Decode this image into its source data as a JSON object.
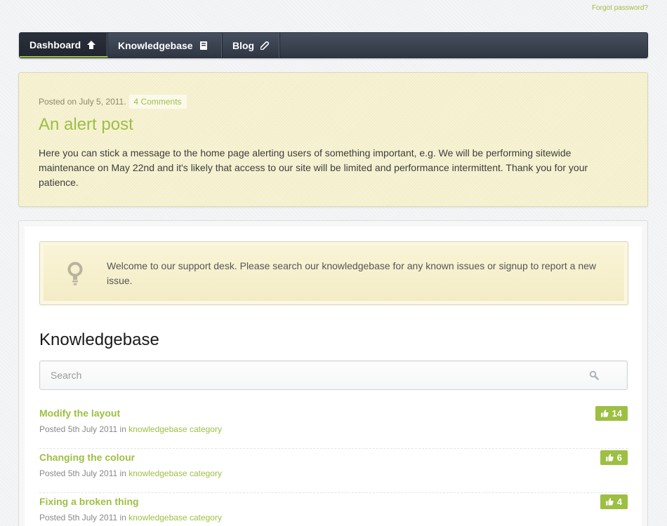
{
  "header": {
    "forgot_password": "Forgot password?"
  },
  "nav": {
    "items": [
      {
        "label": "Dashboard",
        "icon": "home-icon",
        "active": true
      },
      {
        "label": "Knowledgebase",
        "icon": "book-icon",
        "active": false
      },
      {
        "label": "Blog",
        "icon": "pencil-icon",
        "active": false
      }
    ]
  },
  "alert_post": {
    "posted_on": "Posted on July 5, 2011.",
    "comments": "4 Comments",
    "title": "An alert post",
    "body": "Here you can stick a message to the home page alerting users of something important, e.g. We will be performing sitewide maintenance on May 22nd and it's likely that access to our site will be limited and performance intermittent. Thank you for your patience."
  },
  "welcome": {
    "icon": "lightbulb-icon",
    "text": "Welcome to our support desk. Please search our knowledgebase for any known issues or signup to report a new issue."
  },
  "knowledgebase": {
    "title": "Knowledgebase",
    "search_placeholder": "Search",
    "articles": [
      {
        "title": "Modify the layout",
        "posted": "Posted 5th July 2011 in",
        "category": "knowledgebase category",
        "votes": "14"
      },
      {
        "title": "Changing the colour",
        "posted": "Posted 5th July 2011 in",
        "category": "knowledgebase category",
        "votes": "6"
      },
      {
        "title": "Fixing a broken thing",
        "posted": "Posted 5th July 2011 in",
        "category": "knowledgebase category",
        "votes": "4"
      }
    ]
  },
  "colors": {
    "accent": "#9dbf43",
    "nav_bg": "#3a414e",
    "alert_bg": "#f6f1cf"
  }
}
